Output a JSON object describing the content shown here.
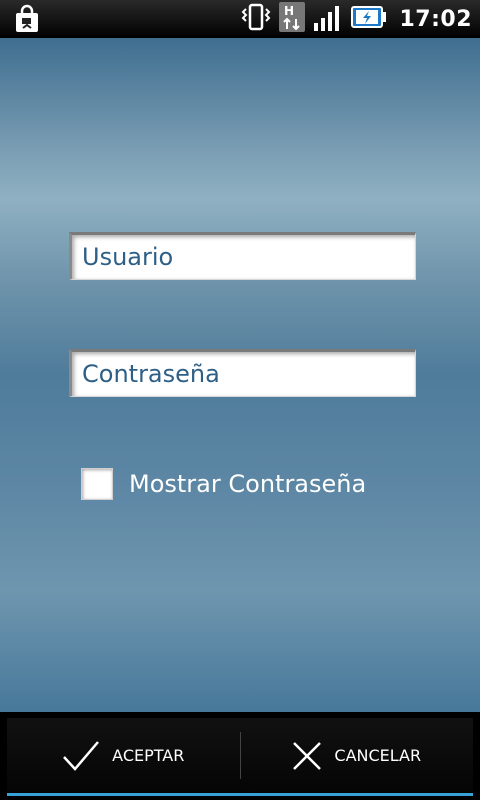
{
  "status_bar": {
    "time": "17:02",
    "left_icon": "shopping-bag-icon",
    "icons": [
      "vibrate-icon",
      "hsdpa-data-icon",
      "signal-bars-icon",
      "battery-charging-icon"
    ]
  },
  "form": {
    "username_placeholder": "Usuario",
    "password_placeholder": "Contraseña",
    "show_password_label": "Mostrar Contraseña",
    "show_password_checked": false
  },
  "actions": {
    "accept_label": "ACEPTAR",
    "cancel_label": "CANCELAR",
    "accept_icon": "check-icon",
    "cancel_icon": "close-icon"
  },
  "colors": {
    "accent": "#37a0d6",
    "field_text": "#2e5f86"
  }
}
